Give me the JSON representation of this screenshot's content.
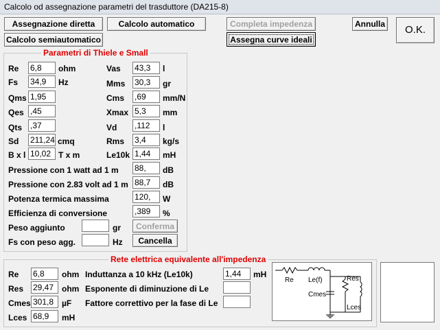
{
  "window": {
    "title": "Calcolo od assegnazione parametri del trasduttore (DA215-8)"
  },
  "buttons": {
    "assegnazione": "Assegnazione diretta",
    "calcolo_auto": "Calcolo automatico",
    "completa": "Completa impedenza",
    "annulla": "Annulla",
    "ok": "O.K.",
    "calcolo_semi": "Calcolo semiautomatico",
    "assegna_curve": "Assegna curve ideali",
    "conferma": "Conferma",
    "cancella": "Cancella"
  },
  "thiele": {
    "legend": "Parametri di Thiele e Small",
    "re": {
      "label": "Re",
      "value": "6,8",
      "unit": "ohm"
    },
    "fs": {
      "label": "Fs",
      "value": "34,9",
      "unit": "Hz"
    },
    "qms": {
      "label": "Qms",
      "value": "1,95"
    },
    "qes": {
      "label": "Qes",
      "value": ",45"
    },
    "qts": {
      "label": "Qts",
      "value": ",37"
    },
    "sd": {
      "label": "Sd",
      "value": "211,24",
      "unit": "cmq"
    },
    "bxl": {
      "label": "B x l",
      "value": "10,02",
      "unit": "T x m"
    },
    "vas": {
      "label": "Vas",
      "value": "43,3",
      "unit": "l"
    },
    "mms": {
      "label": "Mms",
      "value": "30,3",
      "unit": "gr"
    },
    "cms": {
      "label": "Cms",
      "value": ",69",
      "unit": "mm/N"
    },
    "xmax": {
      "label": "Xmax",
      "value": "5,3",
      "unit": "mm"
    },
    "vd": {
      "label": "Vd",
      "value": ",112",
      "unit": "l"
    },
    "rms": {
      "label": "Rms",
      "value": "3,4",
      "unit": "kg/s"
    },
    "le10k": {
      "label": "Le10k",
      "value": "1,44",
      "unit": "mH"
    },
    "p1w": {
      "label": "Pressione con 1 watt ad 1 m",
      "value": "88,",
      "unit": "dB"
    },
    "p283": {
      "label": "Pressione con 2.83 volt ad 1 m",
      "value": "88,7",
      "unit": "dB"
    },
    "potenza": {
      "label": "Potenza termica massima",
      "value": "120,",
      "unit": "W"
    },
    "efficienza": {
      "label": "Efficienza di conversione",
      "value": ",389",
      "unit": "%"
    },
    "peso": {
      "label": "Peso aggiunto",
      "value": "",
      "unit": "gr"
    },
    "fspeso": {
      "label": "Fs con peso agg.",
      "value": "",
      "unit": "Hz"
    }
  },
  "rete": {
    "legend": "Rete elettrica equivalente all'impedenza",
    "re": {
      "label": "Re",
      "value": "6,8",
      "unit": "ohm"
    },
    "res": {
      "label": "Res",
      "value": "29,47",
      "unit": "ohm"
    },
    "cmes": {
      "label": "Cmes",
      "value": "301,8",
      "unit": "µF"
    },
    "lces": {
      "label": "Lces",
      "value": "68,9",
      "unit": "mH"
    },
    "induttanza": {
      "label": "Induttanza a 10 kHz (Le10k)",
      "value": "1,44",
      "unit": "mH"
    },
    "esponente": {
      "label": "Esponente di diminuzione di Le",
      "value": ""
    },
    "fattore": {
      "label": "Fattore correttivo per la fase di Le",
      "value": ""
    }
  },
  "schematic": {
    "re": "Re",
    "lef": "Le(f)",
    "cmes": "Cmes",
    "res": "Res",
    "lces": "Lces"
  }
}
